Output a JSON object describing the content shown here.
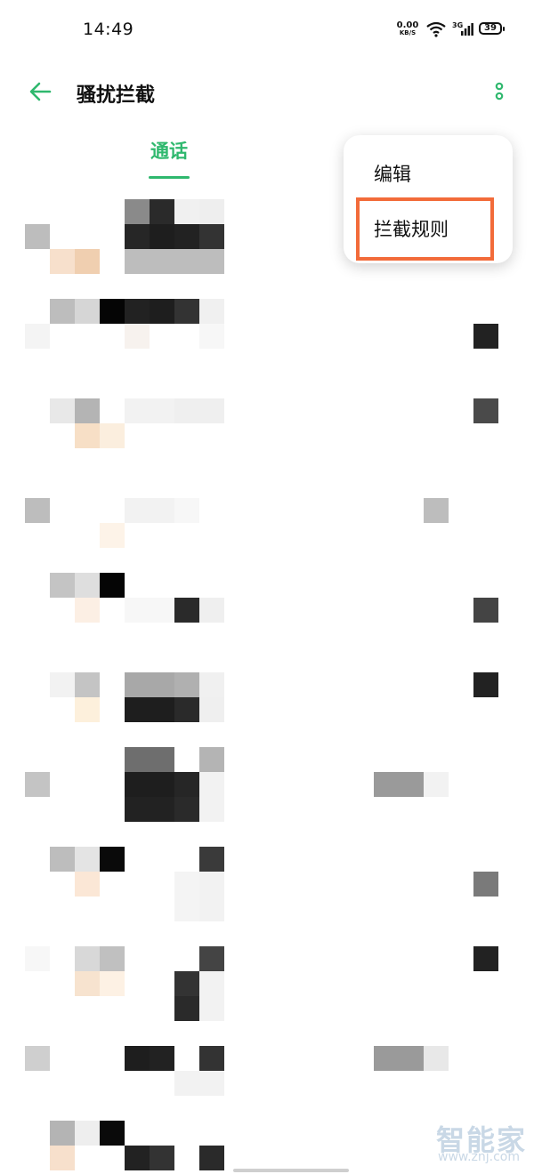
{
  "status_bar": {
    "time": "14:49",
    "net_speed": "0.00",
    "net_unit": "KB/S",
    "cell_type": "3G",
    "battery": "39"
  },
  "header": {
    "back_icon": "arrow-left-icon",
    "title": "骚扰拦截",
    "more_icon": "more-vertical-icon"
  },
  "tabs": [
    {
      "label": "通话",
      "active": true
    }
  ],
  "popup_menu": {
    "items": [
      {
        "label": "编辑"
      },
      {
        "label": "拦截规则",
        "highlighted": true
      }
    ]
  },
  "watermark": {
    "name": "智能家",
    "url": "www.znj.com"
  },
  "colors": {
    "accent": "#2fb86e",
    "highlight_border": "#f26b3a",
    "background": "#ffffff",
    "watermark": "#c9d8e6"
  }
}
